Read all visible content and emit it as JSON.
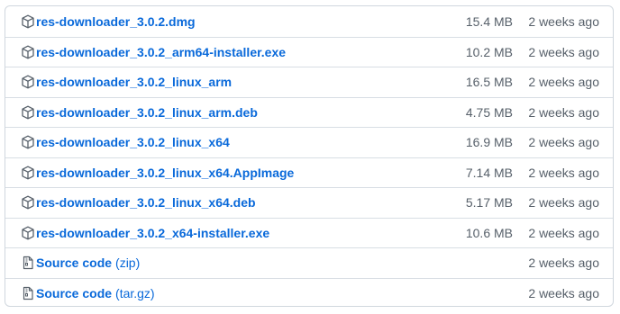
{
  "assets": [
    {
      "name": "res-downloader_3.0.2.dmg",
      "suffix": "",
      "size": "15.4 MB",
      "date": "2 weeks ago",
      "icon": "package-icon"
    },
    {
      "name": "res-downloader_3.0.2_arm64-installer.exe",
      "suffix": "",
      "size": "10.2 MB",
      "date": "2 weeks ago",
      "icon": "package-icon"
    },
    {
      "name": "res-downloader_3.0.2_linux_arm",
      "suffix": "",
      "size": "16.5 MB",
      "date": "2 weeks ago",
      "icon": "package-icon"
    },
    {
      "name": "res-downloader_3.0.2_linux_arm.deb",
      "suffix": "",
      "size": "4.75 MB",
      "date": "2 weeks ago",
      "icon": "package-icon"
    },
    {
      "name": "res-downloader_3.0.2_linux_x64",
      "suffix": "",
      "size": "16.9 MB",
      "date": "2 weeks ago",
      "icon": "package-icon"
    },
    {
      "name": "res-downloader_3.0.2_linux_x64.AppImage",
      "suffix": "",
      "size": "7.14 MB",
      "date": "2 weeks ago",
      "icon": "package-icon"
    },
    {
      "name": "res-downloader_3.0.2_linux_x64.deb",
      "suffix": "",
      "size": "5.17 MB",
      "date": "2 weeks ago",
      "icon": "package-icon"
    },
    {
      "name": "res-downloader_3.0.2_x64-installer.exe",
      "suffix": "",
      "size": "10.6 MB",
      "date": "2 weeks ago",
      "icon": "package-icon"
    },
    {
      "name": "Source code",
      "suffix": "(zip)",
      "size": "",
      "date": "2 weeks ago",
      "icon": "file-zip-icon"
    },
    {
      "name": "Source code",
      "suffix": "(tar.gz)",
      "size": "",
      "date": "2 weeks ago",
      "icon": "file-zip-icon"
    }
  ],
  "colors": {
    "link": "#0969da",
    "muted": "#57606a",
    "border": "#d0d7de"
  }
}
